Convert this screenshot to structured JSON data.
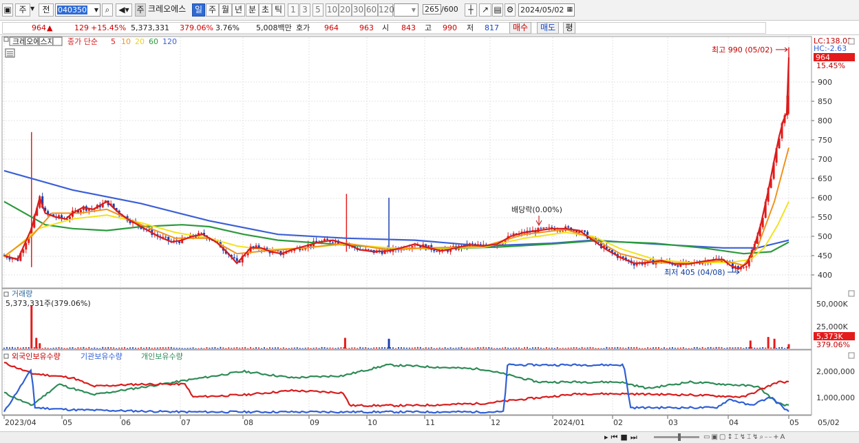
{
  "toolbar": {
    "week_btn": "주",
    "prev_btn": "전",
    "code": "040350",
    "stock_name_btn": "주",
    "stock_name": "크레오에스",
    "period_tabs": [
      "일",
      "주",
      "월",
      "년",
      "분",
      "초",
      "틱"
    ],
    "active_period": "일",
    "interval_tabs": [
      "1",
      "3",
      "5",
      "10",
      "20",
      "30",
      "60",
      "120"
    ],
    "count_current": "265",
    "count_total": "/600",
    "date": "2024/05/02"
  },
  "quote": {
    "price": "964",
    "change": "129",
    "change_pct": "+15.45%",
    "volume": "5,373,331",
    "volume_ratio": "379.06%",
    "turnover": "3.76%",
    "amount": "5,008백만",
    "hoga_label": "호가",
    "ask": "964",
    "bid": "963",
    "open_label": "시",
    "open": "843",
    "high_label": "고",
    "high": "990",
    "low_label": "저",
    "low": "817",
    "buy_btn": "매수",
    "sell_btn": "매도",
    "eval_btn": "평"
  },
  "price_panel": {
    "name_tag": "크레오에스지",
    "legend_prefix": "종가 단순",
    "ma_periods": [
      "5",
      "10",
      "20",
      "60",
      "120"
    ],
    "ma_colors": [
      "#d81c1c",
      "#f0921c",
      "#f2e21c",
      "#2b9a3c",
      "#3a5fd6"
    ],
    "lc": "LC:138.02",
    "hc": "HC:-2.63",
    "last_price": "964",
    "last_pct": "15.45%",
    "high_note": "최고 990 (05/02)",
    "low_note": "최저 405 (04/08)",
    "dividend_note": "배당락(0.00%)",
    "y_ticks": [
      "900",
      "850",
      "800",
      "750",
      "700",
      "650",
      "600",
      "550",
      "500",
      "450",
      "400"
    ]
  },
  "volume_panel": {
    "title": "거래량",
    "summary": "5,373,331주(379.06%)",
    "y_ticks": [
      "50,000K",
      "25,000K"
    ],
    "last_value": "5,373K",
    "last_pct": "379.06%"
  },
  "holding_panel": {
    "legend": [
      "외국인보유수량",
      "기관보유수량",
      "개인보유수량"
    ],
    "colors": [
      "#d81c1c",
      "#2f5fd6",
      "#2e8b57"
    ],
    "y_ticks": [
      "2,000,000",
      "1,000,000"
    ]
  },
  "x_axis": {
    "labels": [
      "2023/04",
      "05",
      "06",
      "07",
      "08",
      "09",
      "10",
      "11",
      "12",
      "2024/01",
      "02",
      "03",
      "04",
      "05"
    ],
    "right_label": "05/02"
  },
  "chart_data": {
    "type": "candlestick",
    "title": "크레오에스지",
    "price_range": [
      385,
      1000
    ],
    "month_labels": [
      "2023/04",
      "05",
      "06",
      "07",
      "08",
      "09",
      "10",
      "11",
      "12",
      "2024/01",
      "02",
      "03",
      "04",
      "05"
    ],
    "close_series": [
      [
        0,
        450
      ],
      [
        20,
        440
      ],
      [
        40,
        520
      ],
      [
        52,
        600
      ],
      [
        60,
        560
      ],
      [
        75,
        550
      ],
      [
        90,
        545
      ],
      [
        100,
        560
      ],
      [
        115,
        575
      ],
      [
        130,
        570
      ],
      [
        150,
        590
      ],
      [
        165,
        565
      ],
      [
        180,
        545
      ],
      [
        195,
        530
      ],
      [
        210,
        515
      ],
      [
        225,
        500
      ],
      [
        245,
        485
      ],
      [
        260,
        490
      ],
      [
        275,
        500
      ],
      [
        290,
        505
      ],
      [
        310,
        485
      ],
      [
        325,
        460
      ],
      [
        340,
        430
      ],
      [
        350,
        450
      ],
      [
        360,
        470
      ],
      [
        375,
        470
      ],
      [
        390,
        460
      ],
      [
        405,
        455
      ],
      [
        420,
        465
      ],
      [
        440,
        475
      ],
      [
        460,
        485
      ],
      [
        480,
        490
      ],
      [
        500,
        480
      ],
      [
        520,
        465
      ],
      [
        540,
        460
      ],
      [
        560,
        462
      ],
      [
        580,
        470
      ],
      [
        600,
        480
      ],
      [
        620,
        470
      ],
      [
        640,
        462
      ],
      [
        660,
        470
      ],
      [
        680,
        478
      ],
      [
        700,
        475
      ],
      [
        720,
        480
      ],
      [
        740,
        500
      ],
      [
        760,
        510
      ],
      [
        780,
        515
      ],
      [
        800,
        520
      ],
      [
        820,
        520
      ],
      [
        840,
        515
      ],
      [
        860,
        490
      ],
      [
        880,
        465
      ],
      [
        900,
        445
      ],
      [
        920,
        430
      ],
      [
        940,
        432
      ],
      [
        960,
        437
      ],
      [
        980,
        428
      ],
      [
        1000,
        428
      ],
      [
        1020,
        435
      ],
      [
        1040,
        440
      ],
      [
        1050,
        440
      ],
      [
        1060,
        425
      ],
      [
        1072,
        415
      ],
      [
        1085,
        430
      ],
      [
        1095,
        470
      ],
      [
        1105,
        530
      ],
      [
        1115,
        610
      ],
      [
        1125,
        700
      ],
      [
        1132,
        760
      ],
      [
        1138,
        800
      ],
      [
        1143,
        820
      ],
      [
        1146,
        964
      ]
    ],
    "ma120": [
      [
        0,
        670
      ],
      [
        100,
        620
      ],
      [
        200,
        585
      ],
      [
        300,
        540
      ],
      [
        400,
        505
      ],
      [
        500,
        495
      ],
      [
        600,
        490
      ],
      [
        700,
        475
      ],
      [
        800,
        482
      ],
      [
        860,
        490
      ],
      [
        950,
        480
      ],
      [
        1050,
        470
      ],
      [
        1100,
        470
      ],
      [
        1146,
        490
      ]
    ],
    "ma60": [
      [
        0,
        590
      ],
      [
        60,
        530
      ],
      [
        100,
        520
      ],
      [
        150,
        515
      ],
      [
        200,
        525
      ],
      [
        260,
        530
      ],
      [
        300,
        525
      ],
      [
        350,
        505
      ],
      [
        400,
        490
      ],
      [
        480,
        480
      ],
      [
        560,
        470
      ],
      [
        640,
        468
      ],
      [
        720,
        472
      ],
      [
        800,
        480
      ],
      [
        860,
        488
      ],
      [
        950,
        482
      ],
      [
        1020,
        470
      ],
      [
        1080,
        455
      ],
      [
        1120,
        460
      ],
      [
        1146,
        485
      ]
    ],
    "ma20": [
      [
        0,
        445
      ],
      [
        50,
        520
      ],
      [
        100,
        545
      ],
      [
        150,
        555
      ],
      [
        200,
        535
      ],
      [
        250,
        510
      ],
      [
        300,
        495
      ],
      [
        340,
        475
      ],
      [
        380,
        465
      ],
      [
        440,
        470
      ],
      [
        500,
        480
      ],
      [
        560,
        470
      ],
      [
        620,
        468
      ],
      [
        700,
        472
      ],
      [
        760,
        495
      ],
      [
        820,
        510
      ],
      [
        860,
        500
      ],
      [
        900,
        468
      ],
      [
        950,
        440
      ],
      [
        1000,
        432
      ],
      [
        1060,
        432
      ],
      [
        1090,
        440
      ],
      [
        1110,
        470
      ],
      [
        1130,
        530
      ],
      [
        1146,
        590
      ]
    ],
    "ma10": [
      [
        0,
        448
      ],
      [
        40,
        500
      ],
      [
        70,
        560
      ],
      [
        110,
        560
      ],
      [
        150,
        570
      ],
      [
        200,
        530
      ],
      [
        250,
        495
      ],
      [
        300,
        495
      ],
      [
        340,
        455
      ],
      [
        380,
        462
      ],
      [
        440,
        470
      ],
      [
        500,
        482
      ],
      [
        560,
        465
      ],
      [
        620,
        470
      ],
      [
        700,
        474
      ],
      [
        760,
        505
      ],
      [
        820,
        518
      ],
      [
        860,
        495
      ],
      [
        900,
        455
      ],
      [
        950,
        432
      ],
      [
        1000,
        430
      ],
      [
        1050,
        437
      ],
      [
        1080,
        425
      ],
      [
        1100,
        470
      ],
      [
        1125,
        590
      ],
      [
        1146,
        730
      ]
    ],
    "volume_spikes": [
      [
        40,
        48
      ],
      [
        47,
        12
      ],
      [
        52,
        6
      ],
      [
        498,
        12
      ],
      [
        562,
        11
      ],
      [
        1090,
        9
      ],
      [
        1116,
        13
      ],
      [
        1125,
        11
      ],
      [
        1146,
        5
      ]
    ],
    "holding_foreign": [
      [
        0,
        2400000
      ],
      [
        40,
        1900000
      ],
      [
        100,
        1700000
      ],
      [
        130,
        1300000
      ],
      [
        200,
        1400000
      ],
      [
        265,
        1400000
      ],
      [
        275,
        800000
      ],
      [
        350,
        900000
      ],
      [
        420,
        1100000
      ],
      [
        495,
        1000000
      ],
      [
        505,
        400000
      ],
      [
        600,
        400000
      ],
      [
        700,
        500000
      ],
      [
        760,
        700000
      ],
      [
        840,
        950000
      ],
      [
        900,
        950000
      ],
      [
        1000,
        900000
      ],
      [
        1080,
        800000
      ],
      [
        1130,
        1500000
      ],
      [
        1146,
        1500000
      ]
    ],
    "holding_institution": [
      [
        0,
        100000
      ],
      [
        40,
        2100000
      ],
      [
        45,
        300000
      ],
      [
        100,
        200000
      ],
      [
        260,
        100000
      ],
      [
        730,
        100000
      ],
      [
        735,
        2300000
      ],
      [
        905,
        2300000
      ],
      [
        915,
        300000
      ],
      [
        1040,
        300000
      ],
      [
        1060,
        700000
      ],
      [
        1090,
        400000
      ],
      [
        1120,
        800000
      ],
      [
        1146,
        100000
      ]
    ],
    "holding_individual": [
      [
        0,
        1000000
      ],
      [
        40,
        400000
      ],
      [
        80,
        1400000
      ],
      [
        130,
        900000
      ],
      [
        270,
        1600000
      ],
      [
        350,
        2000000
      ],
      [
        420,
        1700000
      ],
      [
        495,
        1800000
      ],
      [
        560,
        2300000
      ],
      [
        700,
        2100000
      ],
      [
        780,
        1500000
      ],
      [
        900,
        1500000
      ],
      [
        940,
        1200000
      ],
      [
        1000,
        1500000
      ],
      [
        1100,
        1300000
      ],
      [
        1130,
        500000
      ],
      [
        1146,
        400000
      ]
    ]
  }
}
